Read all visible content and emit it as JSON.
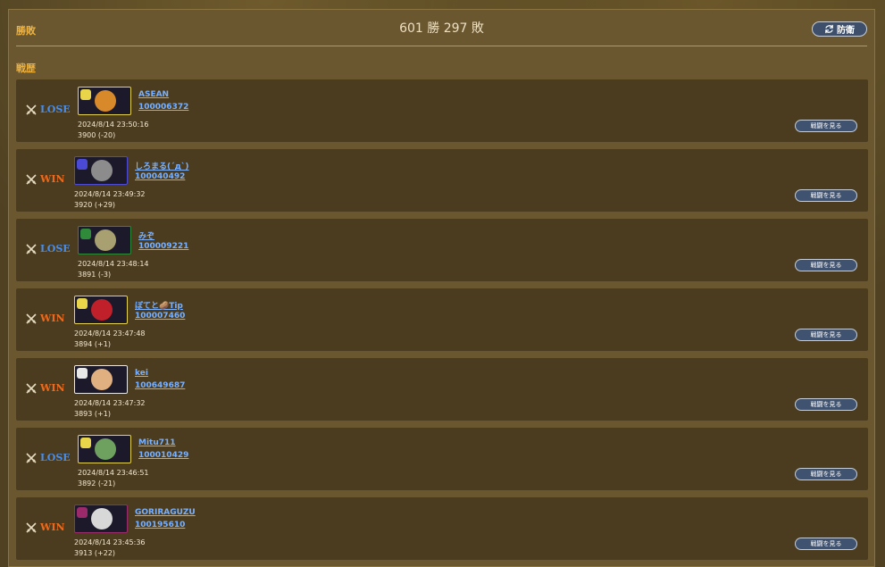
{
  "header": {
    "record_label": "勝敗",
    "summary": "601 勝 297 敗",
    "defense_button": "防衛",
    "history_label": "戦歴"
  },
  "colors": {
    "lose": "#4a8ee8",
    "win": "#ee6a1a",
    "link": "#79b1ff",
    "label": "#f1b23a"
  },
  "battles": [
    {
      "result": "LOSE",
      "name": "ASEAN",
      "id": "100006372",
      "datetime": "2024/8/14 23:50:16",
      "score": "3900 (-20)",
      "view": "戦闘を見る",
      "frame": "#e8d54a",
      "char": "#d88a2a"
    },
    {
      "result": "WIN",
      "name": "しろまる(´д`)",
      "id": "100040492",
      "datetime": "2024/8/14 23:49:32",
      "score": "3920 (+29)",
      "view": "戦闘を見る",
      "frame": "#4a4ad6",
      "char": "#8c8c8c"
    },
    {
      "result": "LOSE",
      "name": "みぞ",
      "id": "100009221",
      "datetime": "2024/8/14 23:48:14",
      "score": "3891 (-3)",
      "view": "戦闘を見る",
      "frame": "#2f8a3a",
      "char": "#a8a070"
    },
    {
      "result": "WIN",
      "name": "ぼてと🥔Tip",
      "id": "100007460",
      "datetime": "2024/8/14 23:47:48",
      "score": "3894 (+1)",
      "view": "戦闘を見る",
      "frame": "#e8d54a",
      "char": "#c0202a"
    },
    {
      "result": "WIN",
      "name": "kei",
      "id": "100649687",
      "datetime": "2024/8/14 23:47:32",
      "score": "3893 (+1)",
      "view": "戦闘を見る",
      "frame": "#e8e8e8",
      "char": "#e0b080"
    },
    {
      "result": "LOSE",
      "name": "Mitu711",
      "id": "100010429",
      "datetime": "2024/8/14 23:46:51",
      "score": "3892 (-21)",
      "view": "戦闘を見る",
      "frame": "#e8d54a",
      "char": "#6ea060"
    },
    {
      "result": "WIN",
      "name": "GORIRAGUZU",
      "id": "100195610",
      "datetime": "2024/8/14 23:45:36",
      "score": "3913 (+22)",
      "view": "戦闘を見る",
      "frame": "#9a2a6a",
      "char": "#d8d8d8"
    }
  ]
}
